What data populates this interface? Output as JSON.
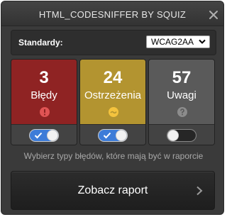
{
  "window": {
    "title": "HTML_CODESNIFFER BY SQUIZ",
    "close_icon": "close-icon"
  },
  "standard": {
    "label": "Standardy:",
    "selected": "WCAG2AA"
  },
  "cards": [
    {
      "id": "errors",
      "count": "3",
      "label": "Błędy",
      "color": "#8f2323",
      "icon": "error-icon",
      "icon_color": "#e05454",
      "enabled": true
    },
    {
      "id": "warnings",
      "count": "24",
      "label": "Ostrzeżenia",
      "color": "#b39430",
      "icon": "warning-icon",
      "icon_color": "#f4c33e",
      "enabled": true
    },
    {
      "id": "notices",
      "count": "57",
      "label": "Uwagi",
      "color": "#5a5a5a",
      "icon": "notice-icon",
      "icon_color": "#8c8c8c",
      "enabled": false
    }
  ],
  "hint": "Wybierz typy błędów, które mają być w raporcie",
  "report_button": {
    "label": "Zobacz raport",
    "icon": "chevron-right-icon"
  }
}
